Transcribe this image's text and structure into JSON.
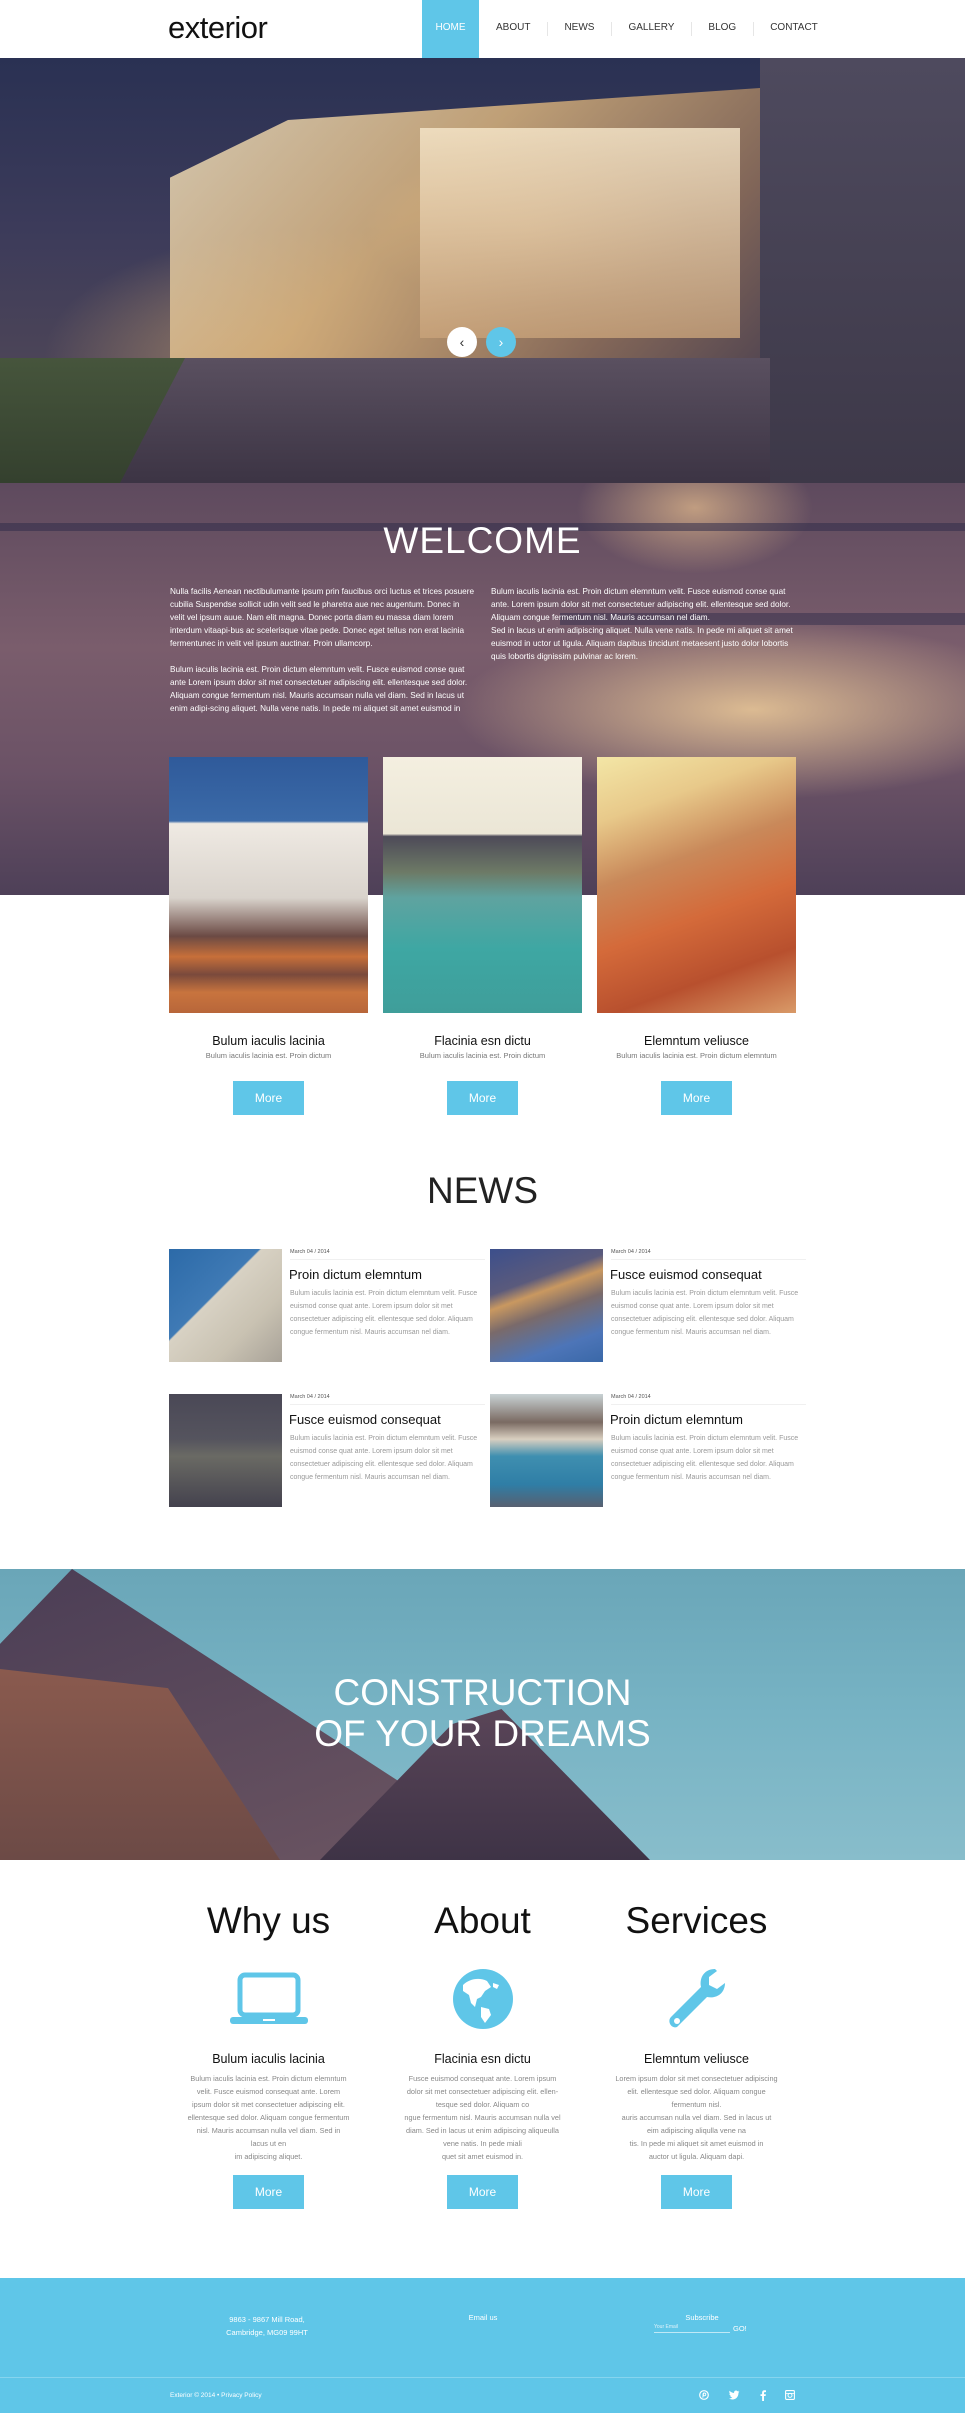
{
  "header": {
    "logo": "exterior",
    "nav": [
      {
        "label": "HOME",
        "active": true
      },
      {
        "label": "ABOUT",
        "active": false
      },
      {
        "label": "NEWS",
        "active": false
      },
      {
        "label": "GALLERY",
        "active": false
      },
      {
        "label": "BLOG",
        "active": false
      },
      {
        "label": "CONTACT",
        "active": false
      }
    ]
  },
  "hero": {
    "prev_icon": "‹",
    "next_icon": "›"
  },
  "welcome": {
    "title": "WELCOME",
    "left_paragraphs": [
      "Nulla facilis Aenean nectibulumante ipsum prin faucibus orci luctus et trices posuere cubilia Suspendse sollicit udin velit sed le pharetra aue nec augentum. Donec in velit vel ipsum auue. Nam elit magna. Donec porta diam eu massa diam lorem interdum vitaapi-bus ac scelerisque vitae pede. Donec eget tellus non erat lacinia fermentunec in velit vel ipsum auctinar. Proin ullamcorp.",
      "Bulum iaculis lacinia est. Proin dictum elemntum velit. Fusce euismod conse quat ante Lorem ipsum dolor sit met consectetuer adipiscing elit. ellentesque sed dolor. Aliquam congue fermentum nisl. Mauris accumsan nulla vel diam. Sed in lacus ut enim adipi-scing aliquet. Nulla vene natis. In pede mi aliquet sit amet euismod in"
    ],
    "right_paragraph_1": "Bulum iaculis lacinia est. Proin dictum elemntum velit. Fusce euismod conse quat ante. Lorem ipsum dolor sit met consectetuer adipiscing elit. ellentesque sed dolor. Aliquam congue fermentum nisl. Mauris accumsan nel diam.",
    "right_paragraph_2": "Sed in lacus ut enim adipiscing aliquet. Nulla vene natis. In pede mi aliquet sit amet euismod in uctor ut ligula. Aliquam dapibus tincidunt metaesent justo dolor lobortis quis lobortis dignissim pulvinar ac lorem."
  },
  "features": [
    {
      "title": "Bulum iaculis lacinia",
      "subtitle": "Bulum iaculis lacinia est. Proin dictum",
      "button": "More"
    },
    {
      "title": "Flacinia esn dictu",
      "subtitle": "Bulum iaculis lacinia est. Proin dictum",
      "button": "More"
    },
    {
      "title": "Elemntum veliusce",
      "subtitle": "Bulum iaculis lacinia est. Proin dictum elemntum",
      "button": "More"
    }
  ],
  "news": {
    "title": "NEWS",
    "items": [
      {
        "date": "March 04 / 2014",
        "title": "Proin dictum elemntum",
        "text": "Bulum iaculis lacinia est. Proin dictum elemntum velit. Fusce euismod conse quat ante. Lorem ipsum dolor sit met consectetuer adipiscing elit. ellentesque sed dolor. Aliquam congue fermentum nisl. Mauris accumsan nel diam."
      },
      {
        "date": "March 04 / 2014",
        "title": "Fusce euismod consequat",
        "text": "Bulum iaculis lacinia est. Proin dictum elemntum velit. Fusce euismod conse quat ante. Lorem ipsum dolor sit met consectetuer adipiscing elit. ellentesque sed dolor. Aliquam congue fermentum nisl. Mauris accumsan nel diam."
      },
      {
        "date": "March 04 / 2014",
        "title": "Fusce euismod consequat",
        "text": "Bulum iaculis lacinia est. Proin dictum elemntum velit. Fusce euismod conse quat ante. Lorem ipsum dolor sit met consectetuer adipiscing elit. ellentesque sed dolor. Aliquam congue fermentum nisl. Mauris accumsan nel diam."
      },
      {
        "date": "March 04 / 2014",
        "title": "Proin dictum elemntum",
        "text": "Bulum iaculis lacinia est. Proin dictum elemntum velit. Fusce euismod conse quat ante. Lorem ipsum dolor sit met consectetuer adipiscing elit. ellentesque sed dolor. Aliquam congue fermentum nisl. Mauris accumsan nel diam."
      }
    ]
  },
  "construction": {
    "line1": "CONSTRUCTION",
    "line2": "OF YOUR DREAMS"
  },
  "columns": [
    {
      "heading": "Why us",
      "icon": "laptop-icon",
      "subtitle": "Bulum iaculis lacinia",
      "text": "Bulum iaculis lacinia est. Proin dictum elemntum\nvelit. Fusce euismod consequat ante. Lorem\nipsum dolor sit met consectetuer adipiscing elit.\nellentesque sed dolor. Aliquam congue fermentum\nnisl. Mauris accumsan nulla vel diam. Sed in\nlacus ut en\nim adipiscing aliquet.",
      "button": "More"
    },
    {
      "heading": "About",
      "icon": "globe-icon",
      "subtitle": "Flacinia esn dictu",
      "text": "Fusce euismod consequat ante. Lorem ipsum\ndolor sit met consectetuer adipiscing elit. ellen-\ntesque sed dolor. Aliquam co\nngue fermentum nisl. Mauris accumsan nulla vel\ndiam. Sed in lacus ut enim adipiscing aliqueulla\nvene natis. In pede miali\nquet sit amet euismod in.",
      "button": "More"
    },
    {
      "heading": "Services",
      "icon": "wrench-icon",
      "subtitle": "Elemntum veliusce",
      "text": "Lorem ipsum dolor sit met consectetuer adipiscing\nelit. ellentesque sed dolor. Aliquam congue\nfermentum nisl.\nauris accumsan nulla vel diam. Sed in lacus ut\neim adipiscing aliqulla vene na\ntis. In pede mi aliquet sit amet euismod in\nauctor ut ligula. Aliquam dapi.",
      "button": "More"
    }
  ],
  "footer": {
    "address_line1": "9863 - 9867 Mill Road,",
    "address_line2": "Cambridge, MG09 99HT",
    "email_label": "Email us",
    "subscribe_label": "Subscribe",
    "subscribe_placeholder": "Your Email",
    "go_label": "GO!",
    "copyright": "Exterior © 2014 • Privacy Policy",
    "social": [
      "pinterest-icon",
      "twitter-icon",
      "facebook-icon",
      "instagram-icon"
    ],
    "accent_color": "#5fc6e8"
  }
}
